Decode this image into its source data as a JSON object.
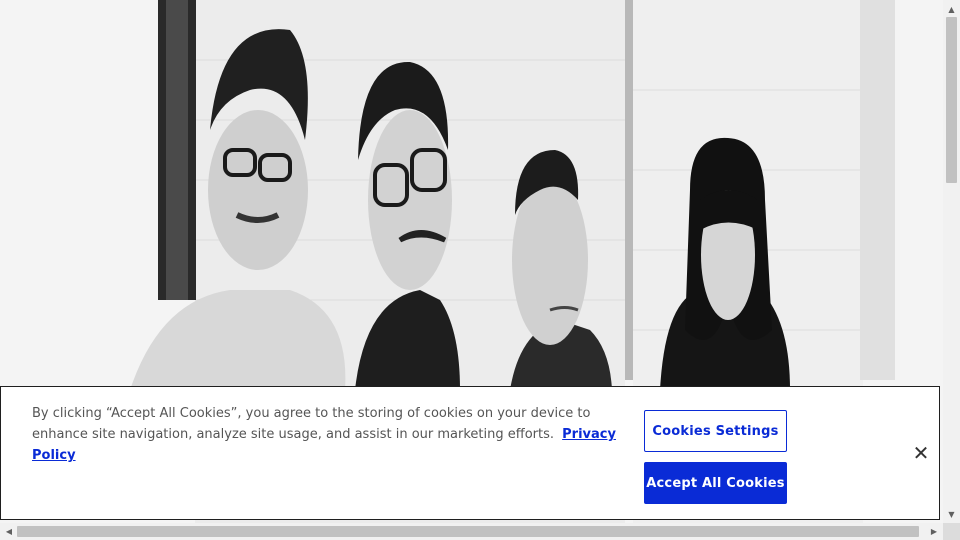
{
  "cookie_banner": {
    "message": "By clicking “Accept All Cookies”, you agree to the storing of cookies on your device to enhance site navigation, analyze site usage, and assist in our marketing efforts.",
    "privacy_link": "Privacy Policy",
    "settings_label": "Cookies Settings",
    "accept_label": "Accept All Cookies",
    "close_glyph": "✕"
  },
  "scrollbars": {
    "up_glyph": "▲",
    "down_glyph": "▼",
    "left_glyph": "◀",
    "right_glyph": "▶"
  },
  "colors": {
    "accent": "#0a2bd6",
    "banner_border": "#1f1f1f",
    "text": "#555555"
  }
}
